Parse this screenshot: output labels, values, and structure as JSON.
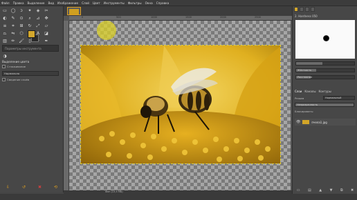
{
  "menubar": {
    "items": [
      "Файл",
      "Правка",
      "Выделение",
      "Вид",
      "Изображение",
      "Слой",
      "Цвет",
      "Инструменты",
      "Фильтры",
      "Окна",
      "Справка"
    ]
  },
  "toolbox": {
    "tools": [
      "rect-select-icon",
      "ellipse-select-icon",
      "lasso-icon",
      "fuzzy-select-icon",
      "color-select-icon",
      "scissors-icon",
      "foreground-select-icon",
      "paths-icon",
      "color-picker-icon",
      "zoom-icon",
      "measure-icon",
      "move-icon",
      "align-icon",
      "crop-icon",
      "unified-transform-icon",
      "rotate-icon",
      "scale-icon",
      "shear-icon",
      "perspective-icon",
      "flip-icon",
      "cage-icon",
      "warp-icon",
      "text-icon",
      "bucket-fill-icon",
      "blend-icon",
      "pencil-icon",
      "paintbrush-icon",
      "eraser-icon",
      "airbrush-icon",
      "ink-icon",
      "mypaint-brush-icon",
      "clone-icon",
      "heal-icon",
      "perspective-clone-icon",
      "blur-icon",
      "smudge-icon",
      "dodge-burn-icon"
    ],
    "search_placeholder": "Параметры инструмента",
    "options_title": "Выделение цвета",
    "options": {
      "antialias_label": "Сглаживание",
      "feather_label": "Растушевать края",
      "mode_value": "Нормально",
      "sample_merged_label": "Сведение слоёв"
    },
    "colors": {
      "foreground": "#d3a72c",
      "background": "#2a2a2a"
    }
  },
  "canvas": {
    "ruler_labels": [
      "0",
      "500",
      "1000",
      "1500",
      "2000",
      "2500"
    ],
    "status_zoom": "",
    "status_file": "Фон (13,5 МБ)"
  },
  "dock": {
    "brush_name": "2. Hardness 050",
    "sliders": [
      {
        "label": "",
        "value": 0.45
      },
      {
        "label": "Жёсткость",
        "value": 0.35
      },
      {
        "label": "Расстояние",
        "value": 0.25
      }
    ],
    "layers_tabs": [
      "Слои",
      "Каналы",
      "Контуры"
    ],
    "mode_label": "Режим",
    "mode_value": "Нормальный",
    "opacity_label": "Непрозрачность",
    "opacity_value": 1.0,
    "lock_label": "Блокировать:",
    "layer_name": "пчела1.jpg"
  }
}
